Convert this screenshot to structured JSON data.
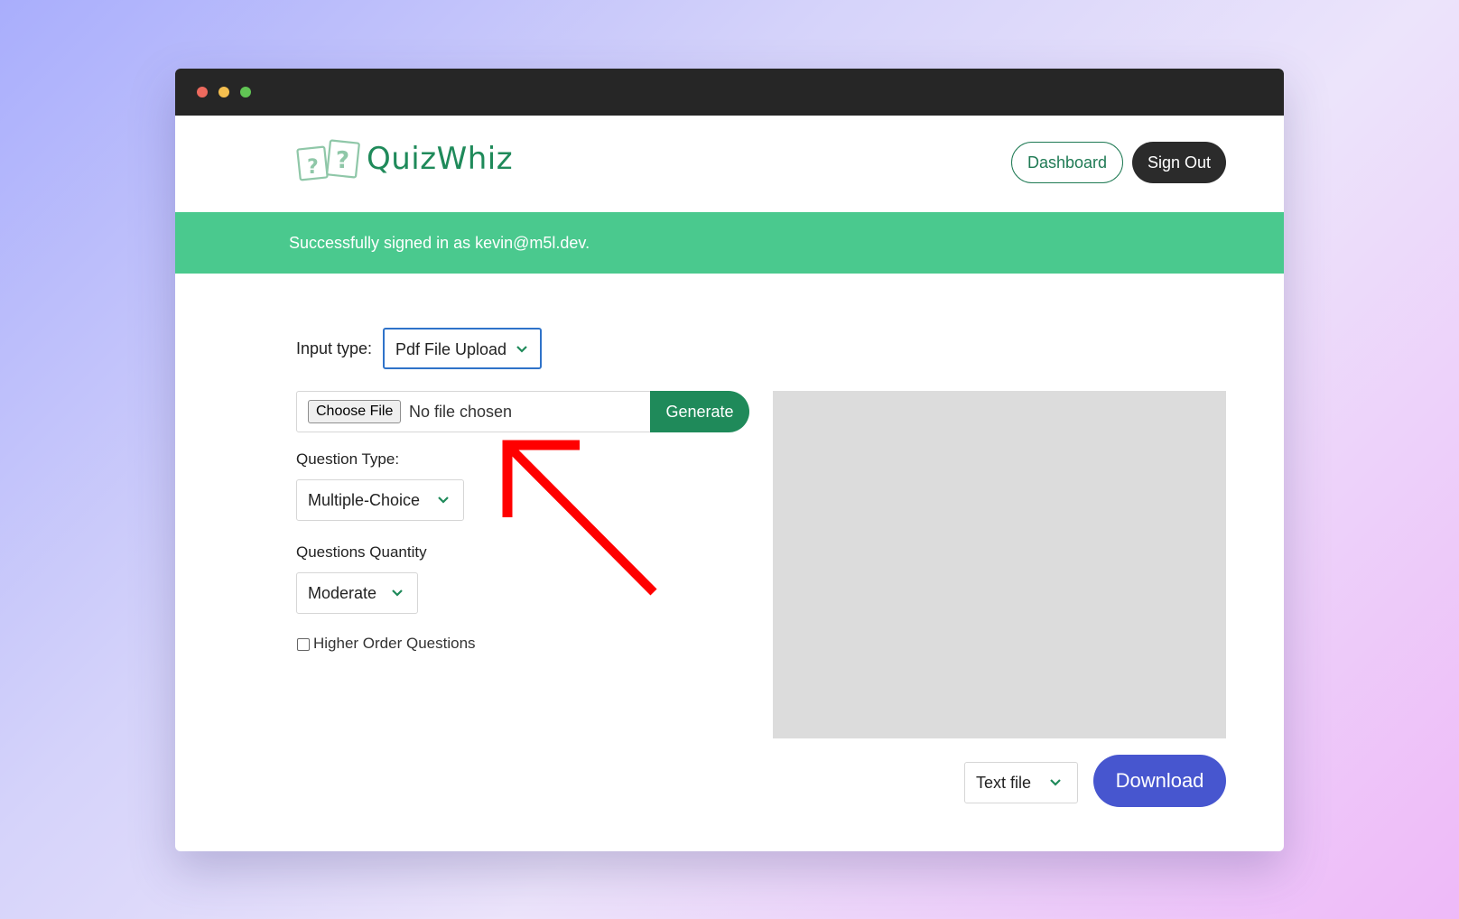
{
  "window": {
    "controls": [
      "close",
      "minimize",
      "maximize"
    ]
  },
  "header": {
    "brand": "QuizWhiz",
    "logo_icon": "question-cards-icon",
    "dashboard_label": "Dashboard",
    "signout_label": "Sign Out"
  },
  "banner": {
    "message": "Successfully signed in as kevin@m5l.dev."
  },
  "form": {
    "input_type_label": "Input type:",
    "input_type_value": "Pdf File Upload",
    "choose_file_label": "Choose File",
    "no_file_text": "No file chosen",
    "generate_label": "Generate",
    "question_type_label": "Question Type:",
    "question_type_value": "Multiple-Choice",
    "questions_quantity_label": "Questions Quantity",
    "questions_quantity_value": "Moderate",
    "higher_order_label": "Higher Order Questions",
    "higher_order_checked": false
  },
  "output": {
    "format_value": "Text file",
    "download_label": "Download"
  },
  "colors": {
    "brand_green": "#1f8a5a",
    "banner_green": "#4ac98e",
    "download_blue": "#4756cf",
    "annotation_arrow": "#ff0000"
  },
  "annotation": {
    "icon": "red-arrow-icon"
  }
}
